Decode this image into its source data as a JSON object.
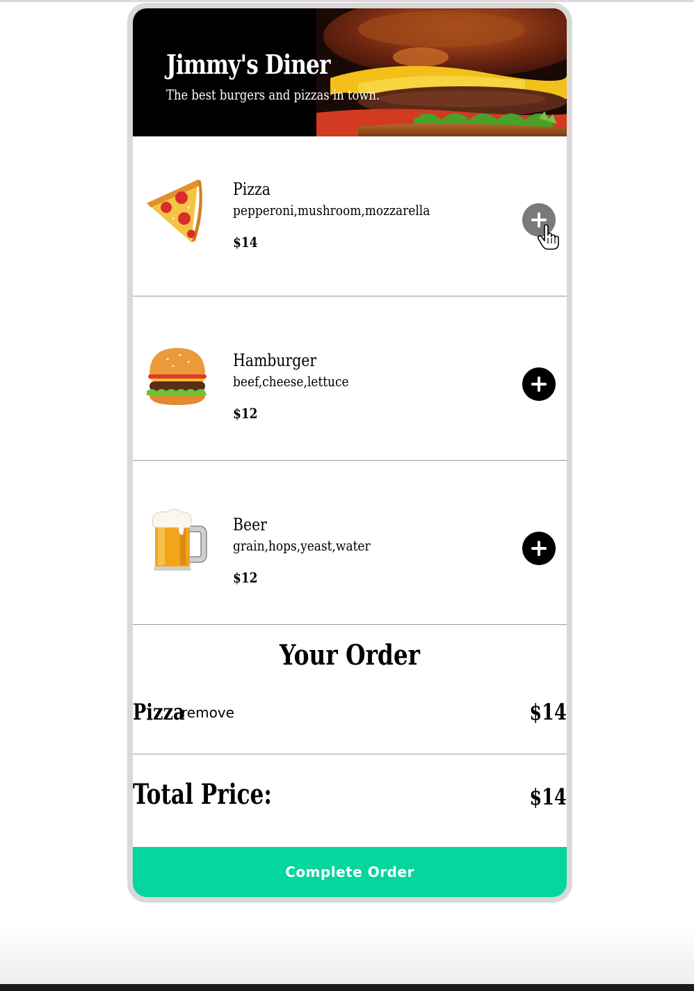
{
  "header": {
    "title": "Jimmy's Diner",
    "subtitle": "The best burgers and pizzas in town."
  },
  "menu": {
    "items": [
      {
        "name": "Pizza",
        "ingredients": "pepperoni,mushroom,mozzarella",
        "price": "$14",
        "icon": "pizza-emoji"
      },
      {
        "name": "Hamburger",
        "ingredients": "beef,cheese,lettuce",
        "price": "$12",
        "icon": "hamburger-emoji"
      },
      {
        "name": "Beer",
        "ingredients": "grain,hops,yeast,water",
        "price": "$12",
        "icon": "beer-emoji"
      }
    ]
  },
  "order": {
    "title": "Your Order",
    "items": [
      {
        "name": "Pizza",
        "remove_label": "remove",
        "price": "$14"
      }
    ],
    "total_label": "Total Price:",
    "total_price": "$14",
    "complete_label": "Complete Order"
  },
  "colors": {
    "accent": "#05d59e",
    "header_bg": "#000000",
    "frame_border": "#d9d9d9",
    "add_button": "#000000",
    "add_button_hover": "#7a7a7a"
  }
}
